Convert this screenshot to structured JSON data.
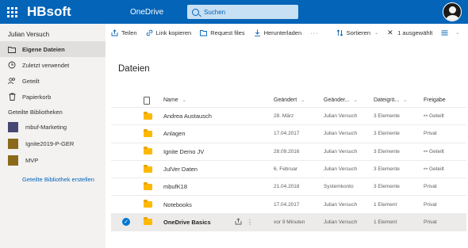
{
  "topbar": {
    "brand": "HBsoft",
    "app_name": "OneDrive",
    "search_placeholder": "Suchen"
  },
  "sidebar": {
    "user_name": "Julian Versuch",
    "nav": [
      {
        "label": "Eigene Dateien",
        "icon": "folder-icon",
        "active": true
      },
      {
        "label": "Zuletzt verwendet",
        "icon": "clock-icon",
        "active": false
      },
      {
        "label": "Geteilt",
        "icon": "people-icon",
        "active": false
      },
      {
        "label": "Papierkorb",
        "icon": "trash-icon",
        "active": false
      }
    ],
    "shared_libraries_title": "Geteilte Bibliotheken",
    "libraries": [
      {
        "label": "mbuf-Marketing",
        "icon": "library-icon",
        "color": "#464775"
      },
      {
        "label": "Ignite2019-P-GER",
        "icon": "library-icon",
        "color": "#8a6a1a"
      },
      {
        "label": "MVP",
        "icon": "library-icon",
        "color": "#8a6a1a"
      }
    ],
    "create_library": "Geteilte Bibliothek erstellen"
  },
  "commandbar": {
    "share": "Teilen",
    "copy_link": "Link kopieren",
    "request_files": "Request files",
    "download": "Herunterladen",
    "more": "···",
    "sort": "Sortieren",
    "selected": "1 ausgewählt"
  },
  "main": {
    "title": "Dateien",
    "columns": {
      "name": "Name",
      "modified": "Geändert",
      "modified_by": "Geänder...",
      "size": "Dateigrö...",
      "sharing": "Freigabe"
    },
    "rows": [
      {
        "name": "Andrea Austausch",
        "modified": "28. März",
        "modified_by": "Julian Versuch",
        "size": "3 Elemente",
        "sharing": "Geteilt",
        "shared": true,
        "selected": false
      },
      {
        "name": "Anlagen",
        "modified": "17.04.2017",
        "modified_by": "Julian Versuch",
        "size": "3 Elemente",
        "sharing": "Privat",
        "shared": false,
        "selected": false
      },
      {
        "name": "Ignite Demo JV",
        "modified": "28.09.2016",
        "modified_by": "Julian Versuch",
        "size": "3 Elemente",
        "sharing": "Geteilt",
        "shared": true,
        "selected": false
      },
      {
        "name": "JulVer Daten",
        "modified": "6. Februar",
        "modified_by": "Julian Versuch",
        "size": "3 Elemente",
        "sharing": "Geteilt",
        "shared": true,
        "selected": false
      },
      {
        "name": "mbufK18",
        "modified": "21.04.2018",
        "modified_by": "Systemkonto",
        "size": "3 Elemente",
        "sharing": "Privat",
        "shared": false,
        "selected": false
      },
      {
        "name": "Notebooks",
        "modified": "17.04.2017",
        "modified_by": "Julian Versuch",
        "size": "1 Element",
        "sharing": "Privat",
        "shared": false,
        "selected": false
      },
      {
        "name": "OneDrive Basics",
        "modified": "vor 9 Minuten",
        "modified_by": "Julian Versuch",
        "size": "1 Element",
        "sharing": "Privat",
        "shared": false,
        "selected": true
      }
    ]
  },
  "colors": {
    "brand_blue": "#0364b8",
    "folder_yellow": "#ffb900",
    "sidebar_bg": "#f3f2f1",
    "selection": "#0078d4"
  }
}
